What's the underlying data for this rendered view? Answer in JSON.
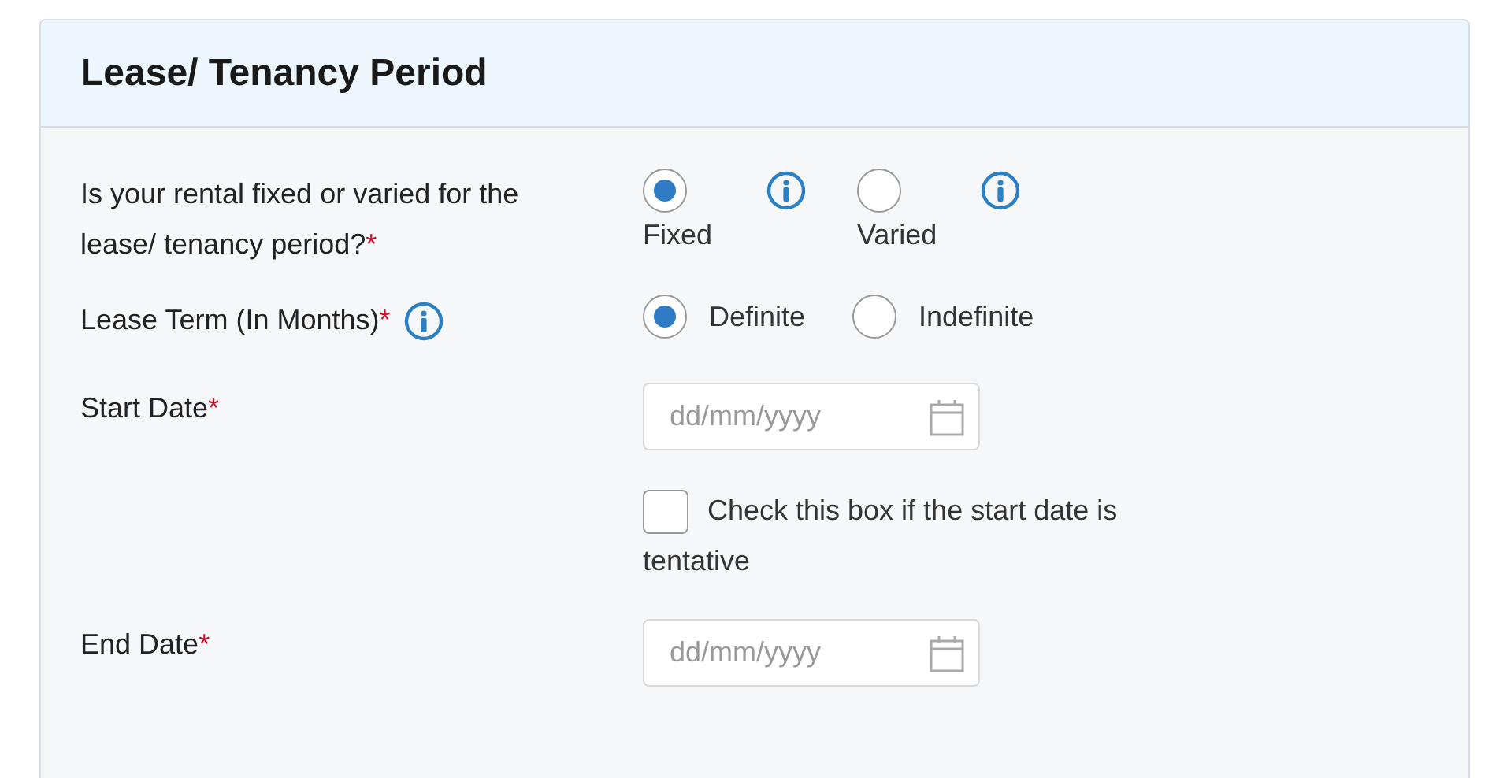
{
  "card": {
    "title": "Lease/ Tenancy Period"
  },
  "rows": [
    {
      "kind": "radio-stacked",
      "label": "Is your rental fixed or varied for the lease/ tenancy period?",
      "mark": "*",
      "options": [
        {
          "label": "Fixed",
          "selected": true,
          "info": true
        },
        {
          "label": "Varied",
          "selected": false,
          "info": true
        }
      ]
    },
    {
      "kind": "radio-inline",
      "label": "Lease Term (In Months)",
      "mark": "*",
      "info": true,
      "options": [
        {
          "label": "Definite",
          "selected": true
        },
        {
          "label": "Indefinite",
          "selected": false
        }
      ]
    },
    {
      "kind": "date",
      "label": "Start Date",
      "mark": "*",
      "placeholder": "dd/mm/yyyy",
      "checkbox": {
        "label": "Check this box if the start date is tentative",
        "checked": false
      }
    },
    {
      "kind": "date",
      "label": "End Date",
      "mark": "*",
      "placeholder": "dd/mm/yyyy"
    }
  ]
}
